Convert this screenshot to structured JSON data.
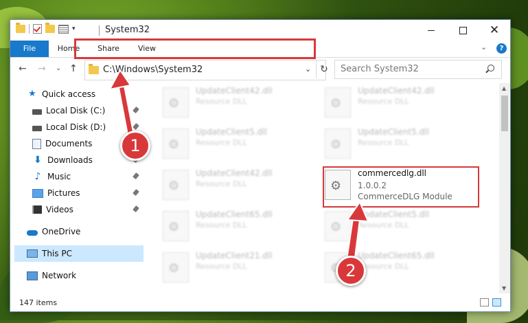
{
  "window": {
    "title": "System32",
    "close_glyph": "✕"
  },
  "ribbon": {
    "tabs": [
      {
        "label": "File"
      },
      {
        "label": "Home"
      },
      {
        "label": "Share"
      },
      {
        "label": "View"
      }
    ],
    "chevron": "⌄",
    "help": "?"
  },
  "navigation": {
    "back": "←",
    "forward": "→",
    "recent": "⌄",
    "up": "↑",
    "address": "C:\\Windows\\System32",
    "address_dropdown": "⌄",
    "refresh": "↻",
    "search_placeholder": "Search System32"
  },
  "sidebar": {
    "items": [
      {
        "label": "Quick access",
        "icon": "star-icon"
      },
      {
        "label": "Local Disk (C:)",
        "icon": "disk-icon"
      },
      {
        "label": "Local Disk (D:)",
        "icon": "disk-icon"
      },
      {
        "label": "Documents",
        "icon": "documents-icon"
      },
      {
        "label": "Downloads",
        "icon": "downloads-icon"
      },
      {
        "label": "Music",
        "icon": "music-icon"
      },
      {
        "label": "Pictures",
        "icon": "pictures-icon"
      },
      {
        "label": "Videos",
        "icon": "videos-icon"
      },
      {
        "label": "OneDrive",
        "icon": "onedrive-icon"
      },
      {
        "label": "This PC",
        "icon": "this-pc-icon"
      },
      {
        "label": "Network",
        "icon": "network-icon"
      }
    ]
  },
  "files": {
    "blurred": [
      {
        "name": "UpdateClient42.dll",
        "type": "Resource DLL"
      },
      {
        "name": "UpdateClient42.dll",
        "type": "Resource DLL"
      },
      {
        "name": "UpdateClient5.dll",
        "type": "Resource DLL"
      },
      {
        "name": "UpdateClient5.dll",
        "type": "Resource DLL"
      },
      {
        "name": "UpdateClient42.dll",
        "type": "Resource DLL"
      },
      {
        "name": "UpdateClient65.dll",
        "type": "Resource DLL"
      },
      {
        "name": "UpdateClient5.dll",
        "type": "Resource DLL"
      },
      {
        "name": "UpdateClient21.dll",
        "type": "Resource DLL"
      },
      {
        "name": "UpdateClient65.dll",
        "type": "Resource DLL"
      }
    ],
    "highlighted": {
      "name": "commercedlg.dll",
      "version": "1.0.0.2",
      "description": "CommerceDLG Module"
    }
  },
  "status": {
    "item_count": "147 items"
  },
  "callouts": {
    "first": "1",
    "second": "2"
  },
  "colors": {
    "accent": "#1979ca",
    "highlight": "#d9383a",
    "selected": "#cce8ff"
  }
}
